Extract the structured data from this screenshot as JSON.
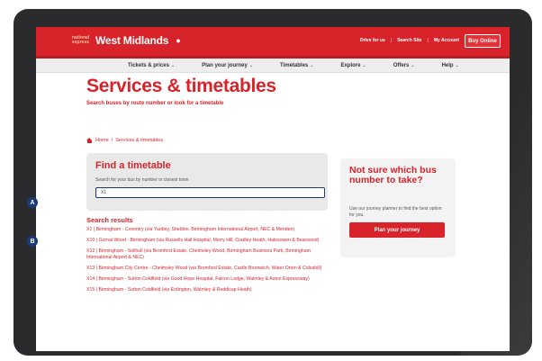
{
  "header": {
    "logo_small": "national express",
    "logo_main": "West Midlands",
    "links": [
      "Drive for us",
      "Search Site",
      "My Account"
    ],
    "buy_button": "Buy Online"
  },
  "nav": [
    "Tickets & prices",
    "Plan your journey",
    "Timetables",
    "Explore",
    "Offers",
    "Help"
  ],
  "page": {
    "title": "Services & timetables",
    "subtitle": "Search buses by route number or look for a timetable"
  },
  "breadcrumb": {
    "home": "Home",
    "separator": "/",
    "current": "Services & timetables"
  },
  "find": {
    "title": "Find a timetable",
    "label": "Search for your bus by number or closest town",
    "input_value": "X1"
  },
  "badges": {
    "a": "A",
    "b": "B"
  },
  "results": {
    "title": "Search results",
    "items": [
      "X1 | Birmingham - Coventry (via Yardley, Sheldon, Birmingham International Airport, NEC & Meriden)",
      "X10 | Gornal Wood - Birmingham (via Russells Hall Hospital, Merry Hill, Cradley Heath, Halesowen & Bearwood)",
      "X12 | Birmingham - Solihull (via Bromford Estate, Chelmsley Wood, Birmingham Business Park, Birmingham International Airport & NEC)",
      "X13 | Birmingham City Centre - Chelmsley Wood (via Bromford Estate, Castle Bromwich, Water Orton & Coleshill)",
      "X14 | Birmingham - Sutton Coldfield (via Good Hope Hospital, Falcon Lodge, Walmley & Aston Expressway)",
      "X15 | Birmingham - Sutton Coldfield (via Erdington, Walmley & Reddicap Heath)"
    ]
  },
  "side": {
    "title": "Not sure which bus number to take?",
    "text": "Use our journey planner to find the best option for you.",
    "button": "Plan your journey"
  },
  "colors": {
    "brand_red": "#d8232a",
    "badge_blue": "#1c3a7a",
    "frame": "#2b2b2d"
  }
}
